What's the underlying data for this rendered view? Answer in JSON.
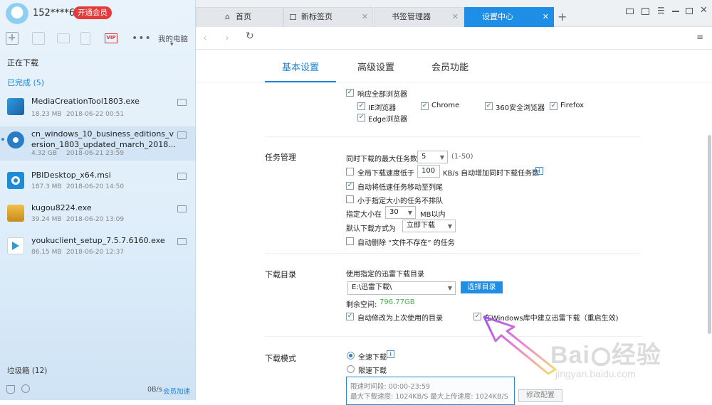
{
  "sidebar": {
    "username": "152****6...",
    "vip_label": "开通会员",
    "my_pc": "我的电脑",
    "more_label": "•••",
    "vip_icon_text": "VIP",
    "downloading": "正在下载",
    "completed": "已完成 (5)",
    "files": [
      {
        "name": "MediaCreationTool1803.exe",
        "size": "18.23 MB",
        "date": "2018-06-22 00:51",
        "icon": "media-creation-tool-icon"
      },
      {
        "name": "cn_windows_10_business_editions_v",
        "name2": "ersion_1803_updated_march_2018...",
        "size": "4.32 GB",
        "date": "2018-06-21 23:59",
        "icon": "disc-icon"
      },
      {
        "name": "PBIDesktop_x64.msi",
        "size": "187.3 MB",
        "date": "2018-06-20 14:50",
        "icon": "installer-gear-icon"
      },
      {
        "name": "kugou8224.exe",
        "size": "39.24 MB",
        "date": "2018-06-20 13:09",
        "icon": "package-box-icon"
      },
      {
        "name": "youkuclient_setup_7.5.7.6160.exe",
        "size": "86.15 MB",
        "date": "2018-06-20 12:37",
        "icon": "youku-player-icon"
      }
    ],
    "trash": "垃圾箱 (12)",
    "speed": "0B/s",
    "boost": "会员加速"
  },
  "tabs": [
    {
      "label": "首页",
      "icon": "home-icon"
    },
    {
      "label": "新标签页"
    },
    {
      "label": "书签管理器"
    },
    {
      "label": "设置中心"
    }
  ],
  "settings_tabs": [
    "基本设置",
    "高级设置",
    "会员功能"
  ],
  "browser": {
    "respond_all": "响应全部浏览器",
    "ie": "IE浏览器",
    "chrome": "Chrome",
    "b360": "360安全浏览器",
    "firefox": "Firefox",
    "edge": "Edge浏览器"
  },
  "task": {
    "title": "任务管理",
    "max_label": "同时下载的最大任务数",
    "max_value": "5",
    "max_range": "(1-50)",
    "speed_label": "全局下载速度低于",
    "speed_value": "100",
    "speed_suffix": "KB/s 自动增加同时下载任务数",
    "move_slow": "自动将低速任务移动至列尾",
    "small_noqueue": "小于指定大小的任务不排队",
    "size_label": "指定大小在",
    "size_value": "30",
    "size_suffix": "MB以内",
    "mode_label": "默认下载方式为",
    "mode_value": "立即下载",
    "auto_delete": "自动删除 “文件不存在” 的任务"
  },
  "dir": {
    "title": "下载目录",
    "use_label": "使用指定的迅雷下载目录",
    "path": "E:\\迅雷下载\\",
    "choose_btn": "选择目录",
    "free_label": "剩余空间:",
    "free_value": "796.77GB",
    "auto_modify": "自动修改为上次使用的目录",
    "win_lib": "在Windows库中建立迅雷下载（重启生效)"
  },
  "mode": {
    "title": "下载模式",
    "full": "全速下载",
    "limit": "限速下载",
    "limit_time": "限速时间段:   00:00-23:59",
    "limit_speed": "最大下载速度:  1024KB/S   最大上传速度:  1024KB/S",
    "modify_btn": "修改配置"
  },
  "watermark": {
    "brand": "Bai",
    "brand2": "经验",
    "url": "jingyan.baidu.com"
  },
  "colors": {
    "accent": "#1e8ee6",
    "vip": "#e8393a",
    "free_space": "#4caf50"
  }
}
